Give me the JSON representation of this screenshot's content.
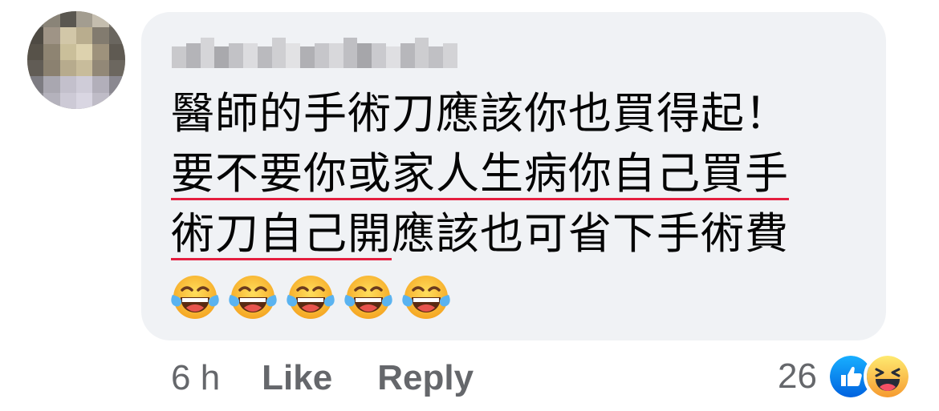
{
  "comment": {
    "text_lines": [
      {
        "underlined": "",
        "plain": "醫師的手術刀應該你也買得起！"
      },
      {
        "underlined": "要不要你或家人生病你自己買手",
        "plain": ""
      },
      {
        "underlined": "術刀自己開",
        "plain": "應該也可省下手術費"
      }
    ],
    "emoji_count": 5,
    "emoji_name": "laughing-with-tears"
  },
  "actions": {
    "time": "6 h",
    "like_label": "Like",
    "reply_label": "Reply"
  },
  "reactions": {
    "count": "26",
    "types": [
      "like",
      "haha"
    ]
  },
  "colors": {
    "bubble_bg": "#f0f2f5",
    "text": "#050505",
    "meta_text": "#65676b",
    "underline": "#e41e3f",
    "like_blue": "#1877f2",
    "emoji_yellow": "#f7b125"
  }
}
